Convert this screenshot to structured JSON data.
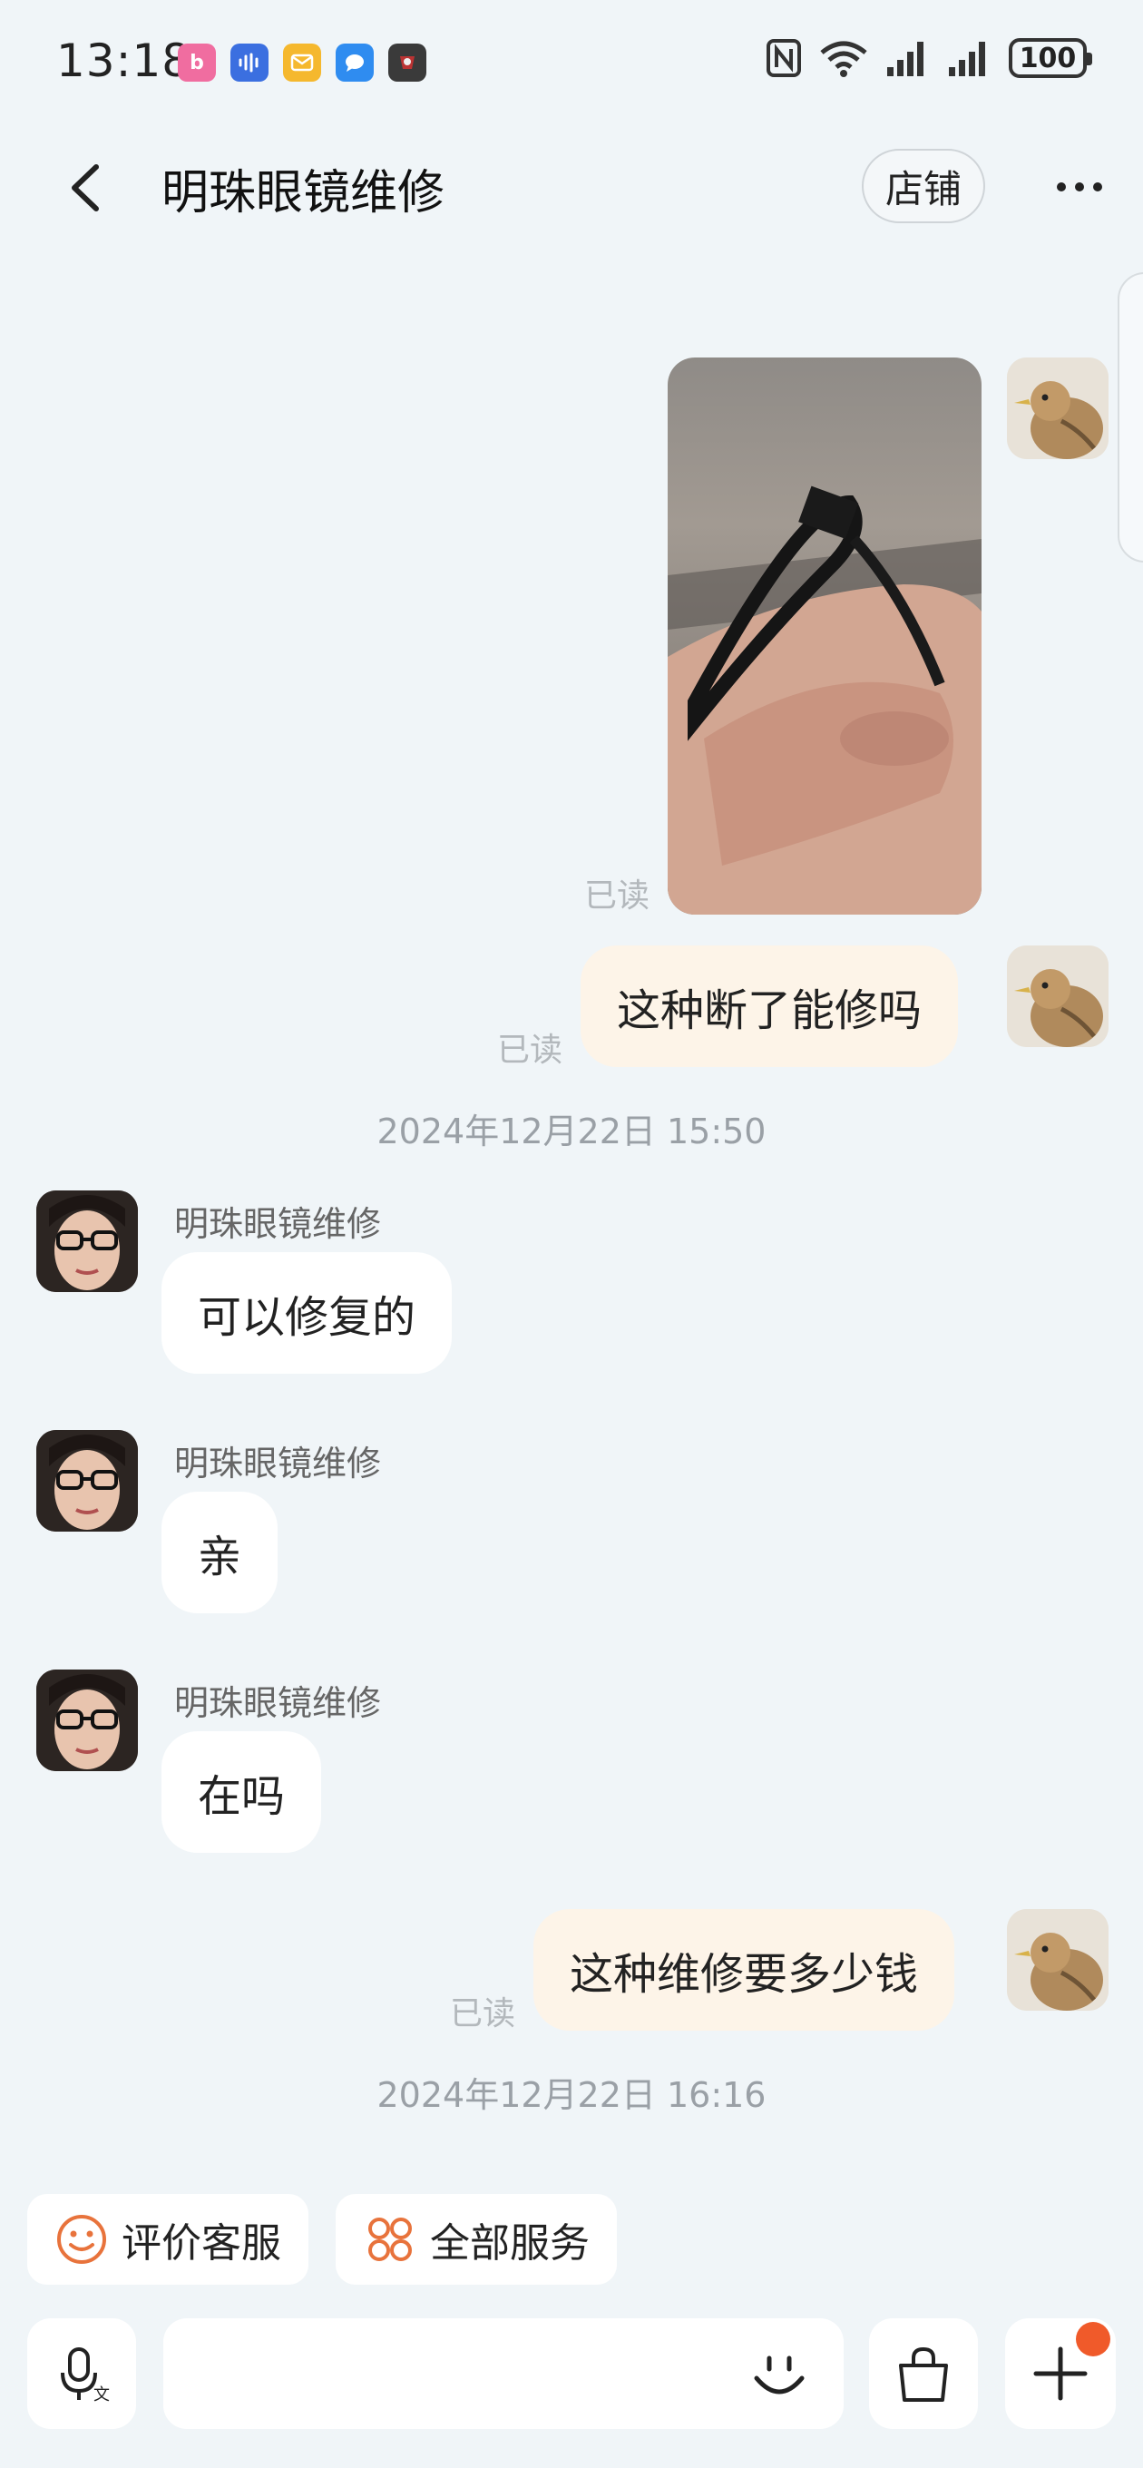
{
  "status_bar": {
    "time": "13:18",
    "battery": "100",
    "app_icons": [
      "bilibili-icon",
      "voice-recorder-icon",
      "mail-icon",
      "messages-icon",
      "game-icon"
    ],
    "system_icons": [
      "nfc-icon",
      "wifi-icon",
      "signal-1-icon",
      "signal-2-icon",
      "battery-icon"
    ]
  },
  "header": {
    "title": "明珠眼镜维修",
    "shop_label": "店铺",
    "back_icon": "chevron-left-icon",
    "more_icon": "more-dots-icon"
  },
  "messages": [
    {
      "from": "me",
      "type": "image",
      "read": "已读"
    },
    {
      "from": "me",
      "type": "text",
      "text": "这种断了能修吗",
      "read": "已读"
    },
    {
      "type": "timestamp",
      "text": "2024年12月22日 15:50"
    },
    {
      "from": "shop",
      "sender": "明珠眼镜维修",
      "text": "可以修复的"
    },
    {
      "from": "shop",
      "sender": "明珠眼镜维修",
      "text": "亲"
    },
    {
      "from": "shop",
      "sender": "明珠眼镜维修",
      "text": "在吗"
    },
    {
      "from": "me",
      "type": "text",
      "text": "这种维修要多少钱",
      "read": "已读"
    },
    {
      "type": "timestamp",
      "text": "2024年12月22日 16:16"
    }
  ],
  "quick_actions": [
    {
      "label": "评价客服",
      "icon": "smiley-icon"
    },
    {
      "label": "全部服务",
      "icon": "grid-flower-icon"
    }
  ],
  "input_bar": {
    "voice_icon": "voice-input-icon",
    "emoji_icon": "emoji-icon",
    "bag_icon": "shopping-bag-icon",
    "plus_icon": "plus-icon"
  },
  "colors": {
    "background": "#f0f5f8",
    "my_bubble": "#fdf4e8",
    "their_bubble": "#ffffff",
    "accent": "#f05a2a",
    "quick_icon": "#e8733c"
  }
}
